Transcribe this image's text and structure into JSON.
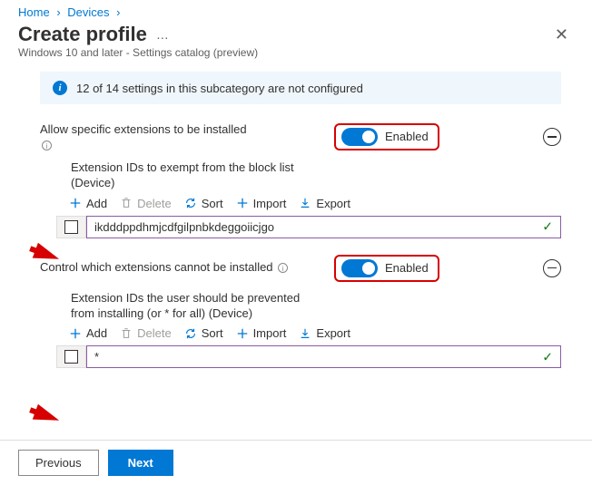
{
  "breadcrumb": {
    "home": "Home",
    "devices": "Devices"
  },
  "header": {
    "title": "Create profile",
    "subtitle": "Windows 10 and later - Settings catalog (preview)"
  },
  "banner": {
    "text": "12 of 14 settings in this subcategory are not configured"
  },
  "toolbar": {
    "add": "Add",
    "delete": "Delete",
    "sort": "Sort",
    "import": "Import",
    "export": "Export"
  },
  "toggle": {
    "enabled": "Enabled"
  },
  "setting1": {
    "label": "Allow specific extensions to be installed",
    "sublabel": "Extension IDs to exempt from the block list (Device)",
    "value": "ikdddppdhmjcdfgilpnbkdeggoiicjgo"
  },
  "setting2": {
    "label": "Control which extensions cannot be installed",
    "sublabel": "Extension IDs the user should be prevented from installing (or * for all) (Device)",
    "value": "*"
  },
  "footer": {
    "previous": "Previous",
    "next": "Next"
  }
}
